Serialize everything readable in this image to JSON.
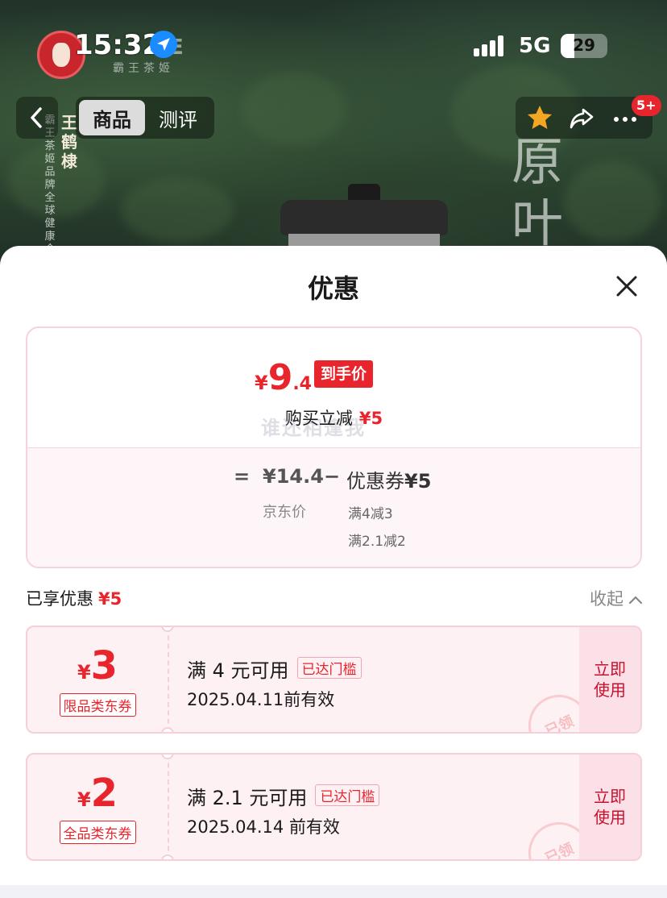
{
  "status": {
    "time": "15:32",
    "network": "5G",
    "battery": "29",
    "battery_level": 0.29
  },
  "brand": {
    "text": "E",
    "subtitle": "霸王茶姬"
  },
  "header": {
    "tabs": [
      {
        "label": "商品",
        "active": true
      },
      {
        "label": "测评",
        "active": false
      }
    ],
    "badge": "5+",
    "vertical_name": "王鹤棣",
    "vertical_sub": "霸王茶姬品牌全球健康合作",
    "vertical_big": "原叶"
  },
  "sheet": {
    "title": "优惠",
    "final_price": {
      "currency": "¥",
      "integer": "9",
      "decimal": ".4",
      "tag": "到手价"
    },
    "instant": {
      "label": "购买立减",
      "amount": "¥5"
    },
    "watermark": "谁还相逢我",
    "formula": {
      "equals": "=",
      "jd_price": "¥14.4",
      "minus": "−",
      "coupon_label": "优惠券",
      "coupon_amount": "¥5",
      "jd_label": "京东价",
      "rules": [
        "满4减3",
        "满2.1减2"
      ]
    },
    "enjoyed": {
      "label": "已享优惠",
      "amount": "¥5"
    },
    "collapse_label": "收起"
  },
  "coupons": [
    {
      "currency": "¥",
      "amount": "3",
      "scope": "限品类东券",
      "condition": "满 4 元可用",
      "reached": "已达门槛",
      "valid": "2025.04.11前有效",
      "action": "立即使用",
      "stamp": "已领"
    },
    {
      "currency": "¥",
      "amount": "2",
      "scope": "全品类东券",
      "condition": "满 2.1 元可用",
      "reached": "已达门槛",
      "valid": "2025.04.14 前有效",
      "action": "立即使用",
      "stamp": "已领"
    }
  ],
  "colors": {
    "accent": "#e8252c",
    "card_border": "#f6d3dd",
    "ticket_bg": "#fdf1f4"
  }
}
